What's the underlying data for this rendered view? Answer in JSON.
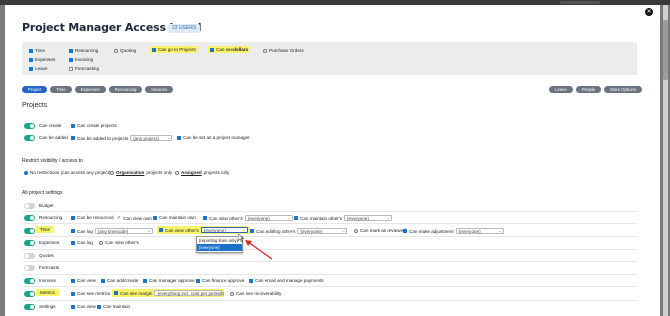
{
  "modal": {
    "title": "Project Manager Access Level",
    "users_badge": "23 USERS",
    "close_glyph": "✕"
  },
  "perms": {
    "time": "Time",
    "expenses": "Expenses",
    "leave": "Leave",
    "resourcing": "Resourcing",
    "invoicing": "Invoicing",
    "forecasting": "Forecasting",
    "quoting": "Quoting",
    "go_to_projects": "Can go to Projects",
    "see_dollars_prefix": "Can see ",
    "see_dollars_bold": "dollars",
    "purchase_orders": "Purchase Orders"
  },
  "tabs": [
    "Project",
    "Time",
    "Expenses",
    "Resourcing",
    "Invoices"
  ],
  "right_tabs": [
    "Leave",
    "People",
    "More Options"
  ],
  "projects": {
    "heading": "Projects",
    "can_create": "Can create",
    "can_create_projects": "Can create projects",
    "can_be_added": "Can be added",
    "can_be_added_to": "Can be added to projects",
    "any_project": "(any project)",
    "can_be_set_pm": "Can be set as a project manager"
  },
  "restrict": {
    "heading": "Restrict visibility / access to",
    "no_restrictions": "No restrictions (can access any project)",
    "organisation_bold": "Organisation",
    "projects_only": " projects only",
    "assigned_bold": "Assigned"
  },
  "all_settings": {
    "heading": "All project settings",
    "budget": "Budget",
    "resourcing": "Resourcing",
    "time": "Time",
    "expenses": "Expenses",
    "quotes": "Quotes",
    "forecasts": "Forecasts",
    "invoices": "Invoices",
    "metrics": "Metrics",
    "settings": "Settings"
  },
  "resourcing_row": {
    "can_be_resourced": "Can be resourced",
    "can_view_own": "Can view own",
    "can_maintain_own": "Can maintain own",
    "can_view_others": "Can view other's",
    "can_maintain_others": "Can maintain other's",
    "everyone": "(everyone)"
  },
  "time_row": {
    "can_log": "Can log",
    "any_timecode": "(any timecode)",
    "can_view_others": "Can view other's",
    "everyone": "(everyone)",
    "can_edit_log": "Can edit/log other's",
    "can_mark_reviewed": "Can mark as reviewed",
    "can_make_adjustment": "Can make adjustment"
  },
  "expenses_row": {
    "can_log": "Can log",
    "can_view_others": "Can view other's"
  },
  "invoices_row": {
    "can_view": "Can view",
    "can_add_create": "Can add/create",
    "can_manager_approve": "Can manager approve",
    "can_finance_approve": "Can finance approve",
    "can_email": "Can email and manage payments"
  },
  "metrics_row": {
    "can_see_metrics": "Can see metrics",
    "can_see_margin": "Can see margin",
    "margin_value": "(everything incl. cost per person)",
    "can_see_recoverability": "Can see recoverability"
  },
  "settings_row": {
    "can_view": "Can view",
    "can_maintain": "Can maintain"
  },
  "dropdown": {
    "option1": "(reporting lines only)",
    "option2": "(everyone)"
  },
  "colors": {
    "accent": "#2563c9",
    "toggle_on": "#1aa58a",
    "highlight": "#f7f36a",
    "arrow": "#e02424"
  }
}
